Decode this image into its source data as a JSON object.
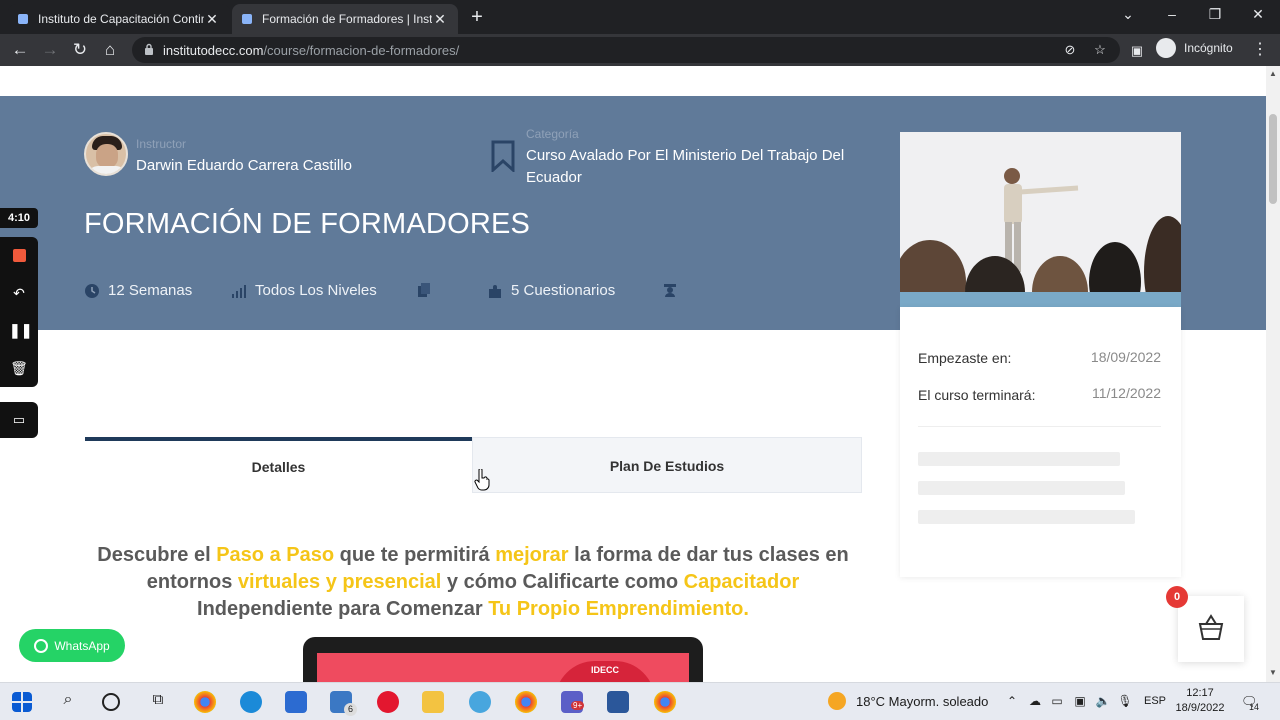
{
  "browser": {
    "tabs": [
      {
        "title": "Instituto de Capacitación Contin",
        "active": false
      },
      {
        "title": "Formación de Formadores | Instit",
        "active": true
      }
    ],
    "url_domain": "institutodecc.com",
    "url_path": "/course/formacion-de-formadores/",
    "profile_label": "Incógnito"
  },
  "recorder": {
    "timer": "4:10"
  },
  "course": {
    "instructor_label": "Instructor",
    "instructor_name": "Darwin Eduardo Carrera Castillo",
    "category_label": "Categoría",
    "category_line1": "Curso Avalado Por El Ministerio Del Trabajo Del",
    "category_line2": "Ecuador",
    "title": "FORMACIÓN DE FORMADORES",
    "meta": {
      "duration": "12 Semanas",
      "level": "Todos Los Niveles",
      "quizzes": "5 Cuestionarios"
    }
  },
  "card": {
    "started_label": "Empezaste en:",
    "started_value": "18/09/2022",
    "ends_label": "El curso terminará:",
    "ends_value": "11/12/2022"
  },
  "tabs": {
    "details": "Detalles",
    "plan": "Plan De Estudios"
  },
  "promo": {
    "p1": "Descubre el ",
    "h1": "Paso a Paso",
    "p2": " que te permitirá ",
    "h2": "mejorar",
    "p3": " la forma de dar tus clases en entornos ",
    "h3": "virtuales y presencial",
    "p4": " y cómo Calificarte como ",
    "h4": "Capacitador",
    "p5": " Independiente para Comenzar ",
    "h5": "Tu Propio Emprendimiento."
  },
  "laptop_badge": "IDECC",
  "whatsapp_label": "WhatsApp",
  "cart_count": "0",
  "taskbar": {
    "weather": "18°C  Mayorm. soleado",
    "language": "ESP",
    "time": "12:17",
    "date": "18/9/2022",
    "mail_badge": "6",
    "teams_badge": "9+",
    "notif_count": "14"
  },
  "colors": {
    "hero_bg": "#607a99",
    "highlight": "#f5c518",
    "tab_active_border": "#1f3a5a",
    "whatsapp": "#25d366",
    "cart_badge": "#e53935"
  }
}
